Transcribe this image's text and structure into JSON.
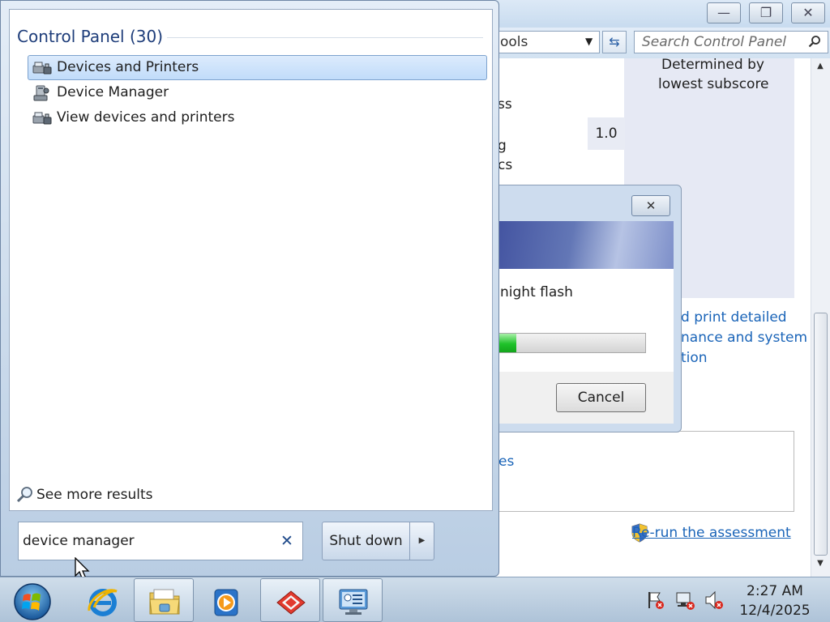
{
  "control_panel_window": {
    "caption_buttons": {
      "minimize": "—",
      "restore": "❐",
      "close": "✕"
    },
    "address_text": "ools",
    "search_placeholder": "Search Control Panel",
    "score_header_line1": "Determined by",
    "score_header_line2": "lowest subscore",
    "partial_texts": {
      "row1": "ss",
      "row2a": "g",
      "row2b": "cs"
    },
    "score_value": "1.0",
    "partial_links": {
      "line1": "d print detailed",
      "line2": "nance and system",
      "line3": "tion",
      "box_link": "es"
    },
    "rerun_link": "Re-run the assessment"
  },
  "progress_dialog": {
    "message": "night flash",
    "progress_fraction": 0.18,
    "cancel_label": "Cancel"
  },
  "start_menu": {
    "heading": "Control Panel (30)",
    "results": [
      {
        "label": "Devices and Printers",
        "icon": "devices-printers-icon",
        "selected": true
      },
      {
        "label": "Device Manager",
        "icon": "device-manager-icon",
        "selected": false
      },
      {
        "label": "View devices and printers",
        "icon": "devices-printers-icon",
        "selected": false
      }
    ],
    "see_more_label": "See more results",
    "search_value": "device manager",
    "shutdown_label": "Shut down"
  },
  "taskbar": {
    "pinned": [
      {
        "name": "internet-explorer",
        "icon": "internet-explorer-icon",
        "open": false
      },
      {
        "name": "windows-explorer",
        "icon": "folder-icon",
        "open": true
      },
      {
        "name": "media-player",
        "icon": "media-player-icon",
        "open": false
      },
      {
        "name": "benchmark-app",
        "icon": "benchmark-app-icon",
        "open": true
      },
      {
        "name": "control-panel",
        "icon": "control-panel-icon",
        "open": true
      }
    ],
    "tray_icons": [
      "action-center-flag-icon",
      "network-icon",
      "volume-muted-icon"
    ],
    "clock_time": "2:27 AM",
    "clock_date": "12/4/2025"
  },
  "colors": {
    "accent_link": "#1a64b8",
    "progress_green": "#1fc22a",
    "selection": "#c1dcfa"
  }
}
